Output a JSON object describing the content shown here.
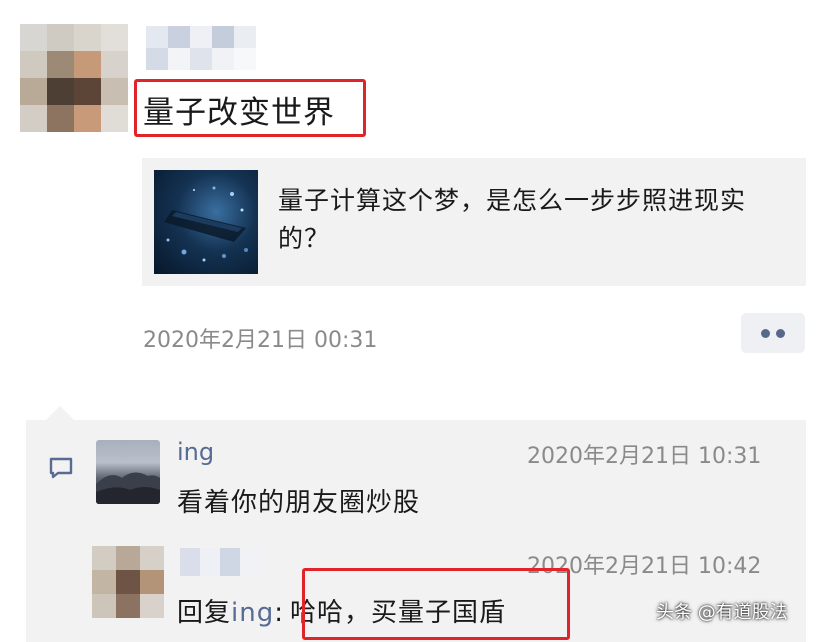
{
  "post": {
    "text": "量子改变世界",
    "time": "2020年2月21日 00:31",
    "link": {
      "title": "量子计算这个梦，是怎么一步步照进现实的？"
    }
  },
  "comments": [
    {
      "author": "ing",
      "time": "2020年2月21日 10:31",
      "text": "看着你的朋友圈炒股"
    },
    {
      "time": "2020年2月21日 10:42",
      "reply_prefix": "回复",
      "reply_to": "ing",
      "reply_sep": ":",
      "text": "哈哈，买量子国盾"
    }
  ],
  "watermark": "头条 @有道股法",
  "icons": {
    "more": "more-dots-icon",
    "comment": "comment-icon"
  },
  "colors": {
    "link_name": "#576b95",
    "highlight": "#e0242a",
    "card_bg": "#f2f2f2",
    "timestamp": "#8a8a8a"
  }
}
